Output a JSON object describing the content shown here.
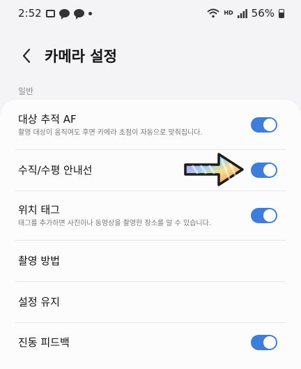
{
  "status_bar": {
    "time": "2:52",
    "network": "HD",
    "battery": "56%"
  },
  "header": {
    "title": "카메라 설정"
  },
  "section": {
    "label": "일반"
  },
  "settings": [
    {
      "title": "대상 추적 AF",
      "description": "촬영 대상이 움직여도 후면 카메라 초점이 자동으로 맞춰집니다.",
      "toggle": true,
      "enabled": true
    },
    {
      "title": "수직/수평 안내선",
      "description": "",
      "toggle": true,
      "enabled": true
    },
    {
      "title": "위치 태그",
      "description": "태그를 추가하면 사진이나 동영상을 촬영한 장소를 알 수 있습니다.",
      "toggle": true,
      "enabled": true
    },
    {
      "title": "촬영 방법",
      "description": "",
      "toggle": false
    },
    {
      "title": "설정 유지",
      "description": "",
      "toggle": false
    },
    {
      "title": "진동 피드백",
      "description": "",
      "toggle": true,
      "enabled": true
    }
  ],
  "colors": {
    "toggle_on": "#3e7ddb",
    "background": "#f4f4f6",
    "card": "#fcfcfd"
  }
}
